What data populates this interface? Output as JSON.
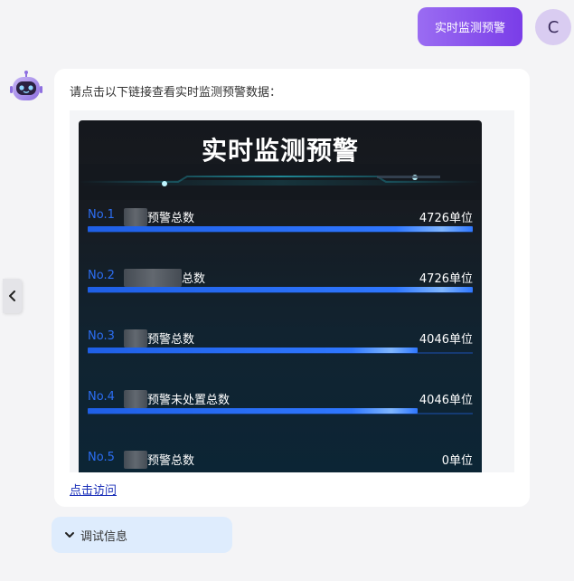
{
  "user": {
    "message": "实时监测预警",
    "avatar_letter": "C"
  },
  "bot": {
    "intro_text": "请点击以下链接查看实时监测预警数据：",
    "link_label": "点击访问",
    "debug_label": "调试信息"
  },
  "dashboard": {
    "title": "实时监测预警",
    "rows": [
      {
        "no": "No.1",
        "name": "预警总数",
        "value": "4726单位",
        "fill_fraction": 1.0
      },
      {
        "no": "No.2",
        "name": "总数",
        "value": "4726单位",
        "fill_fraction": 1.0
      },
      {
        "no": "No.3",
        "name": "预警总数",
        "value": "4046单位",
        "fill_fraction": 0.856
      },
      {
        "no": "No.4",
        "name": "预警未处置总数",
        "value": "4046单位",
        "fill_fraction": 0.856
      },
      {
        "no": "No.5",
        "name": "预警总数",
        "value": "0单位",
        "fill_fraction": 0
      }
    ]
  },
  "colors": {
    "accent_purple": "#7a3de8",
    "rank_blue": "#2c6ef2",
    "link_blue": "#1a2fb8",
    "debug_bg": "#deecfd"
  },
  "icons": {
    "side_toggle": "chevron-left-icon",
    "debug": "chevron-down-icon",
    "bot_avatar": "robot-icon"
  }
}
